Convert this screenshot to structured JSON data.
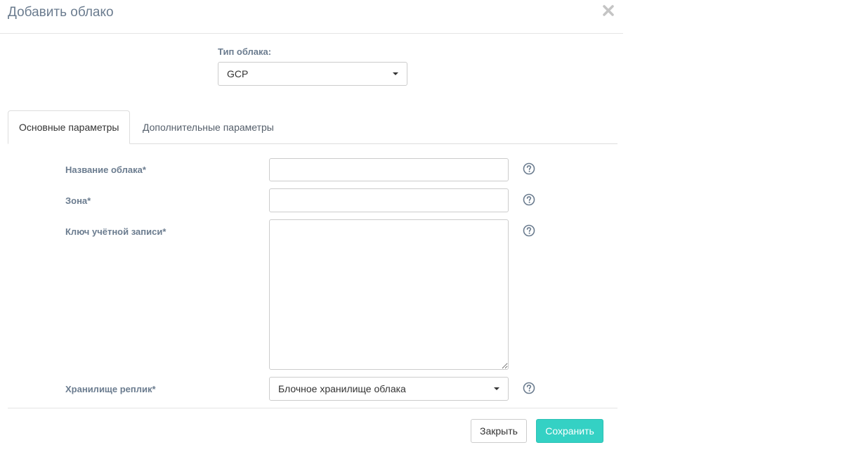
{
  "dialog": {
    "title": "Добавить облако",
    "close_icon": "close-icon"
  },
  "cloud_type": {
    "label": "Тип облака:",
    "selected": "GCP"
  },
  "tabs": [
    {
      "label": "Основные параметры",
      "active": true
    },
    {
      "label": "Дополнительные параметры",
      "active": false
    }
  ],
  "form": {
    "cloud_name": {
      "label": "Название облака*",
      "value": ""
    },
    "zone": {
      "label": "Зона*",
      "value": ""
    },
    "account_key": {
      "label": "Ключ учётной записи*",
      "value": ""
    },
    "replica_storage": {
      "label": "Хранилище реплик*",
      "selected": "Блочное хранилище облака"
    },
    "help_icon": "question-circle-icon"
  },
  "footer": {
    "close_label": "Закрыть",
    "save_label": "Сохранить"
  },
  "colors": {
    "accent": "#34d1c4",
    "label": "#6b7c8f",
    "border": "#cccccc"
  }
}
